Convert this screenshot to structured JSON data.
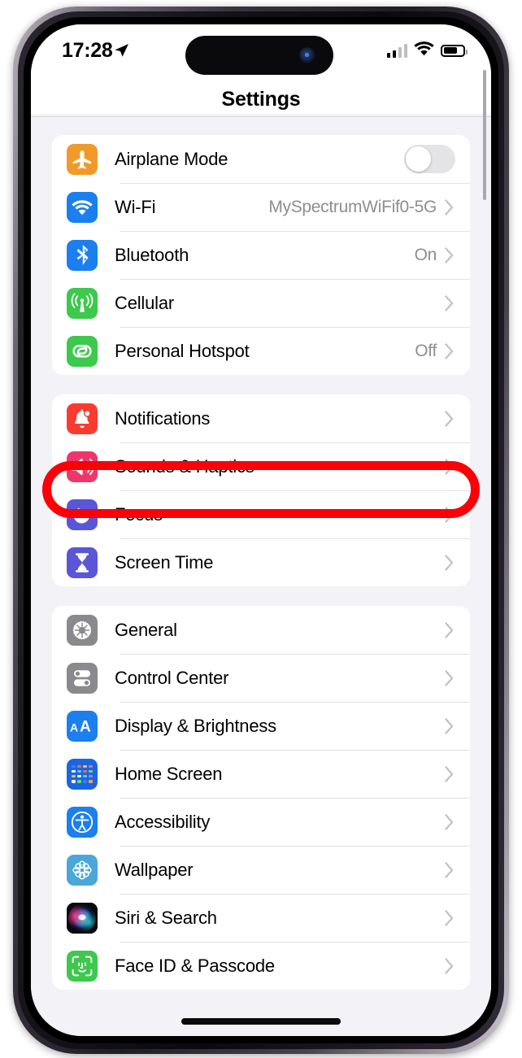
{
  "status_bar": {
    "time": "17:28",
    "location_icon": "location-arrow-icon",
    "cellular_icon": "cellular-signal-icon",
    "cellular_bars_filled": 2,
    "wifi_icon": "wifi-icon",
    "battery_icon": "battery-icon",
    "battery_level_pct": 62
  },
  "nav": {
    "title": "Settings"
  },
  "annotation": {
    "shape": "oval",
    "color": "#fb0007",
    "target": "Sounds & Haptics"
  },
  "groups": [
    {
      "id": "connectivity",
      "rows": [
        {
          "label": "Airplane Mode",
          "icon": "airplane-icon",
          "icon_color": "#f09a29",
          "control": "toggle",
          "toggle_on": false
        },
        {
          "label": "Wi-Fi",
          "icon": "wifi-icon",
          "icon_color": "#1b7ff0",
          "value": "MySpectrumWiFif0-5G",
          "control": "chevron"
        },
        {
          "label": "Bluetooth",
          "icon": "bluetooth-icon",
          "icon_color": "#1b7ff0",
          "value": "On",
          "control": "chevron"
        },
        {
          "label": "Cellular",
          "icon": "cellular-antenna-icon",
          "icon_color": "#3cc94c",
          "value": "",
          "control": "chevron"
        },
        {
          "label": "Personal Hotspot",
          "icon": "hotspot-icon",
          "icon_color": "#3cc94c",
          "value": "Off",
          "control": "chevron"
        }
      ]
    },
    {
      "id": "alerts",
      "rows": [
        {
          "label": "Notifications",
          "icon": "bell-icon",
          "icon_color": "#fc3b30",
          "value": "",
          "control": "chevron"
        },
        {
          "label": "Sounds & Haptics",
          "icon": "speaker-waves-icon",
          "icon_color": "#f0356a",
          "value": "",
          "control": "chevron",
          "highlighted": true
        },
        {
          "label": "Focus",
          "icon": "moon-icon",
          "icon_color": "#5a56d8",
          "value": "",
          "control": "chevron"
        },
        {
          "label": "Screen Time",
          "icon": "hourglass-icon",
          "icon_color": "#5a56d8",
          "value": "",
          "control": "chevron"
        }
      ]
    },
    {
      "id": "system",
      "rows": [
        {
          "label": "General",
          "icon": "gear-icon",
          "icon_color": "#8a8a8e",
          "value": "",
          "control": "chevron"
        },
        {
          "label": "Control Center",
          "icon": "control-center-icon",
          "icon_color": "#8a8a8e",
          "value": "",
          "control": "chevron"
        },
        {
          "label": "Display & Brightness",
          "icon": "text-size-aa-icon",
          "icon_color": "#1b7ff0",
          "value": "",
          "control": "chevron"
        },
        {
          "label": "Home Screen",
          "icon": "home-screen-grid-icon",
          "icon_color": "#1b66e0",
          "value": "",
          "control": "chevron"
        },
        {
          "label": "Accessibility",
          "icon": "accessibility-icon",
          "icon_color": "#1b7ff0",
          "value": "",
          "control": "chevron"
        },
        {
          "label": "Wallpaper",
          "icon": "wallpaper-flower-icon",
          "icon_color": "#4aa7d8",
          "value": "",
          "control": "chevron"
        },
        {
          "label": "Siri & Search",
          "icon": "siri-orb-icon",
          "icon_color": "#1b1020",
          "value": "",
          "control": "chevron"
        },
        {
          "label": "Face ID & Passcode",
          "icon": "face-id-icon",
          "icon_color": "#3cc94c",
          "value": "",
          "control": "chevron"
        }
      ]
    }
  ]
}
